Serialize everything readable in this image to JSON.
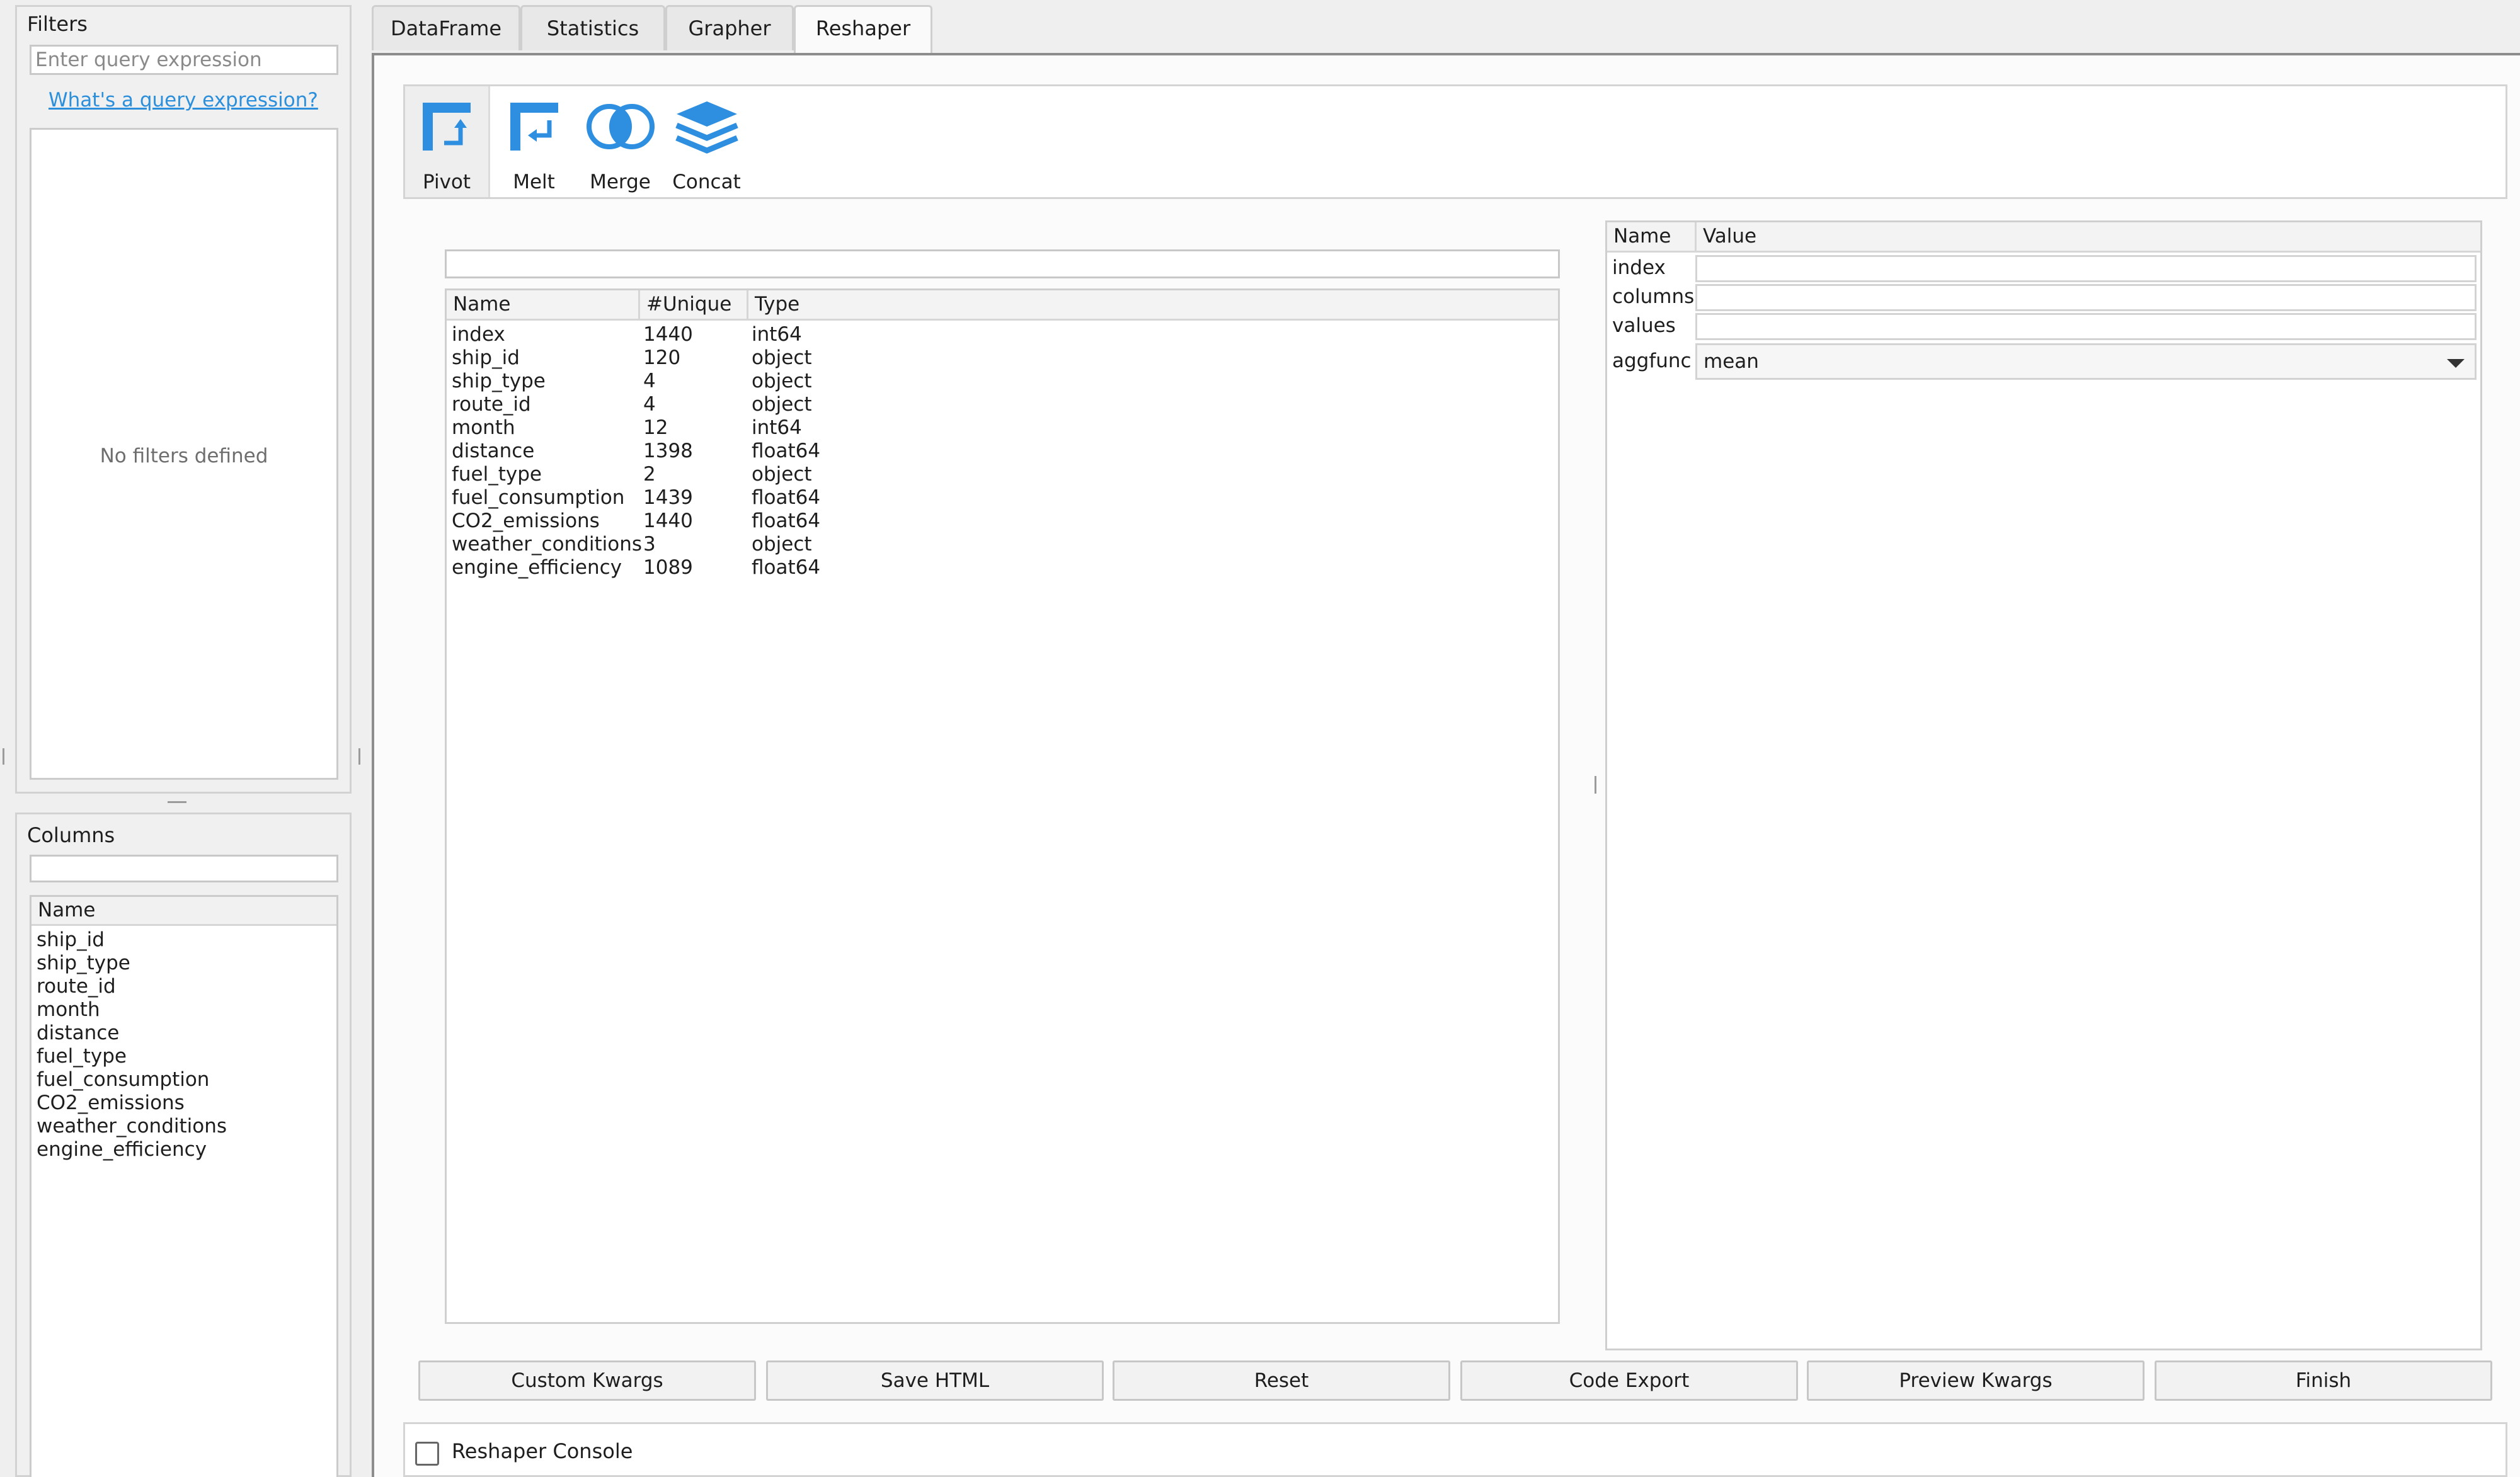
{
  "filters": {
    "title": "Filters",
    "query_placeholder": "Enter query expression",
    "help_link": "What's a query expression?",
    "empty_message": "No filters defined"
  },
  "columns_panel": {
    "title": "Columns",
    "search_value": "",
    "header": "Name",
    "items": [
      "ship_id",
      "ship_type",
      "route_id",
      "month",
      "distance",
      "fuel_type",
      "fuel_consumption",
      "CO2_emissions",
      "weather_conditions",
      "engine_efficiency"
    ]
  },
  "tabs": [
    {
      "label": "DataFrame",
      "active": false
    },
    {
      "label": "Statistics",
      "active": false
    },
    {
      "label": "Grapher",
      "active": false
    },
    {
      "label": "Reshaper",
      "active": true
    }
  ],
  "reshaper": {
    "tools": [
      {
        "label": "Pivot",
        "icon": "pivot-icon",
        "active": true
      },
      {
        "label": "Melt",
        "icon": "melt-icon",
        "active": false
      },
      {
        "label": "Merge",
        "icon": "merge-icon",
        "active": false
      },
      {
        "label": "Concat",
        "icon": "concat-icon",
        "active": false
      }
    ],
    "icon_color": "#2e8fe0",
    "search_value": "",
    "table": {
      "headers": [
        "Name",
        "#Unique",
        "Type"
      ],
      "rows": [
        [
          "index",
          "1440",
          "int64"
        ],
        [
          "ship_id",
          "120",
          "object"
        ],
        [
          "ship_type",
          "4",
          "object"
        ],
        [
          "route_id",
          "4",
          "object"
        ],
        [
          "month",
          "12",
          "int64"
        ],
        [
          "distance",
          "1398",
          "float64"
        ],
        [
          "fuel_type",
          "2",
          "object"
        ],
        [
          "fuel_consumption",
          "1439",
          "float64"
        ],
        [
          "CO2_emissions",
          "1440",
          "float64"
        ],
        [
          "weather_conditions",
          "3",
          "object"
        ],
        [
          "engine_efficiency",
          "1089",
          "float64"
        ]
      ]
    },
    "kwargs": {
      "headers": [
        "Name",
        "Value"
      ],
      "rows": [
        {
          "name": "index",
          "value": ""
        },
        {
          "name": "columns",
          "value": ""
        },
        {
          "name": "values",
          "value": ""
        },
        {
          "name": "aggfunc",
          "value": "mean"
        }
      ]
    },
    "buttons": [
      "Custom Kwargs",
      "Save HTML",
      "Reset",
      "Code Export",
      "Preview Kwargs",
      "Finish"
    ],
    "console_label": "Reshaper Console",
    "console_checked": false
  }
}
